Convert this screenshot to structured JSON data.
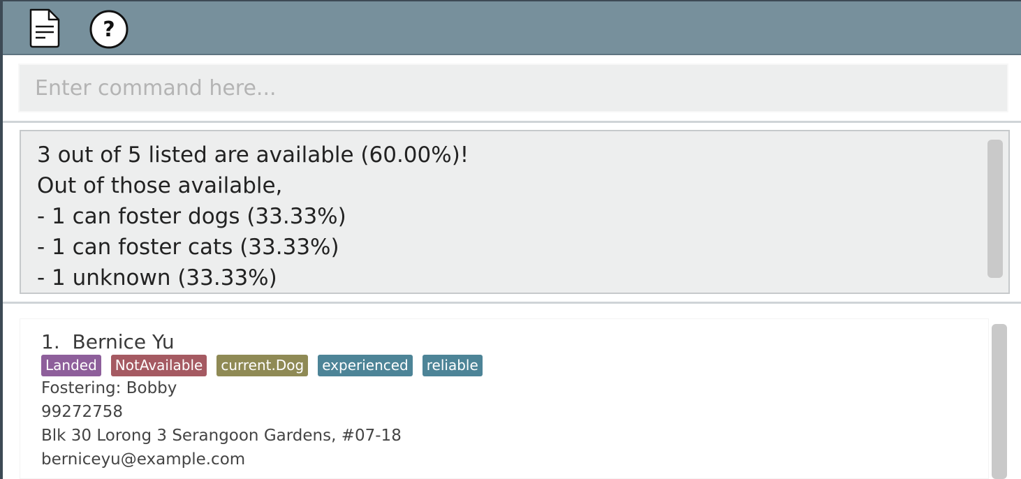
{
  "toolbar": {
    "file_icon": "file-icon",
    "help_icon": "help-icon",
    "help_glyph": "?"
  },
  "command": {
    "placeholder": "Enter command here...",
    "value": ""
  },
  "result": {
    "lines": [
      "3 out of 5 listed are available (60.00%)!",
      "Out of those available,",
      "- 1 can foster dogs (33.33%)",
      "- 1 can foster cats (33.33%)",
      "- 1 unknown (33.33%)"
    ]
  },
  "list": {
    "items": [
      {
        "index": "1.",
        "name": "Bernice Yu",
        "tags": [
          {
            "label": "Landed",
            "color": "#8e5f9b"
          },
          {
            "label": "NotAvailable",
            "color": "#a55a62"
          },
          {
            "label": "current.Dog",
            "color": "#8f8a55"
          },
          {
            "label": "experienced",
            "color": "#4d8497"
          },
          {
            "label": "reliable",
            "color": "#4d8497"
          }
        ],
        "fostering": "Fostering: Bobby",
        "phone": "99272758",
        "address": "Blk 30 Lorong 3 Serangoon Gardens, #07-18",
        "email": "berniceyu@example.com"
      }
    ]
  },
  "colors": {
    "topbar": "#77909c",
    "command_bg": "#edeeee",
    "result_bg": "#edeeee"
  }
}
